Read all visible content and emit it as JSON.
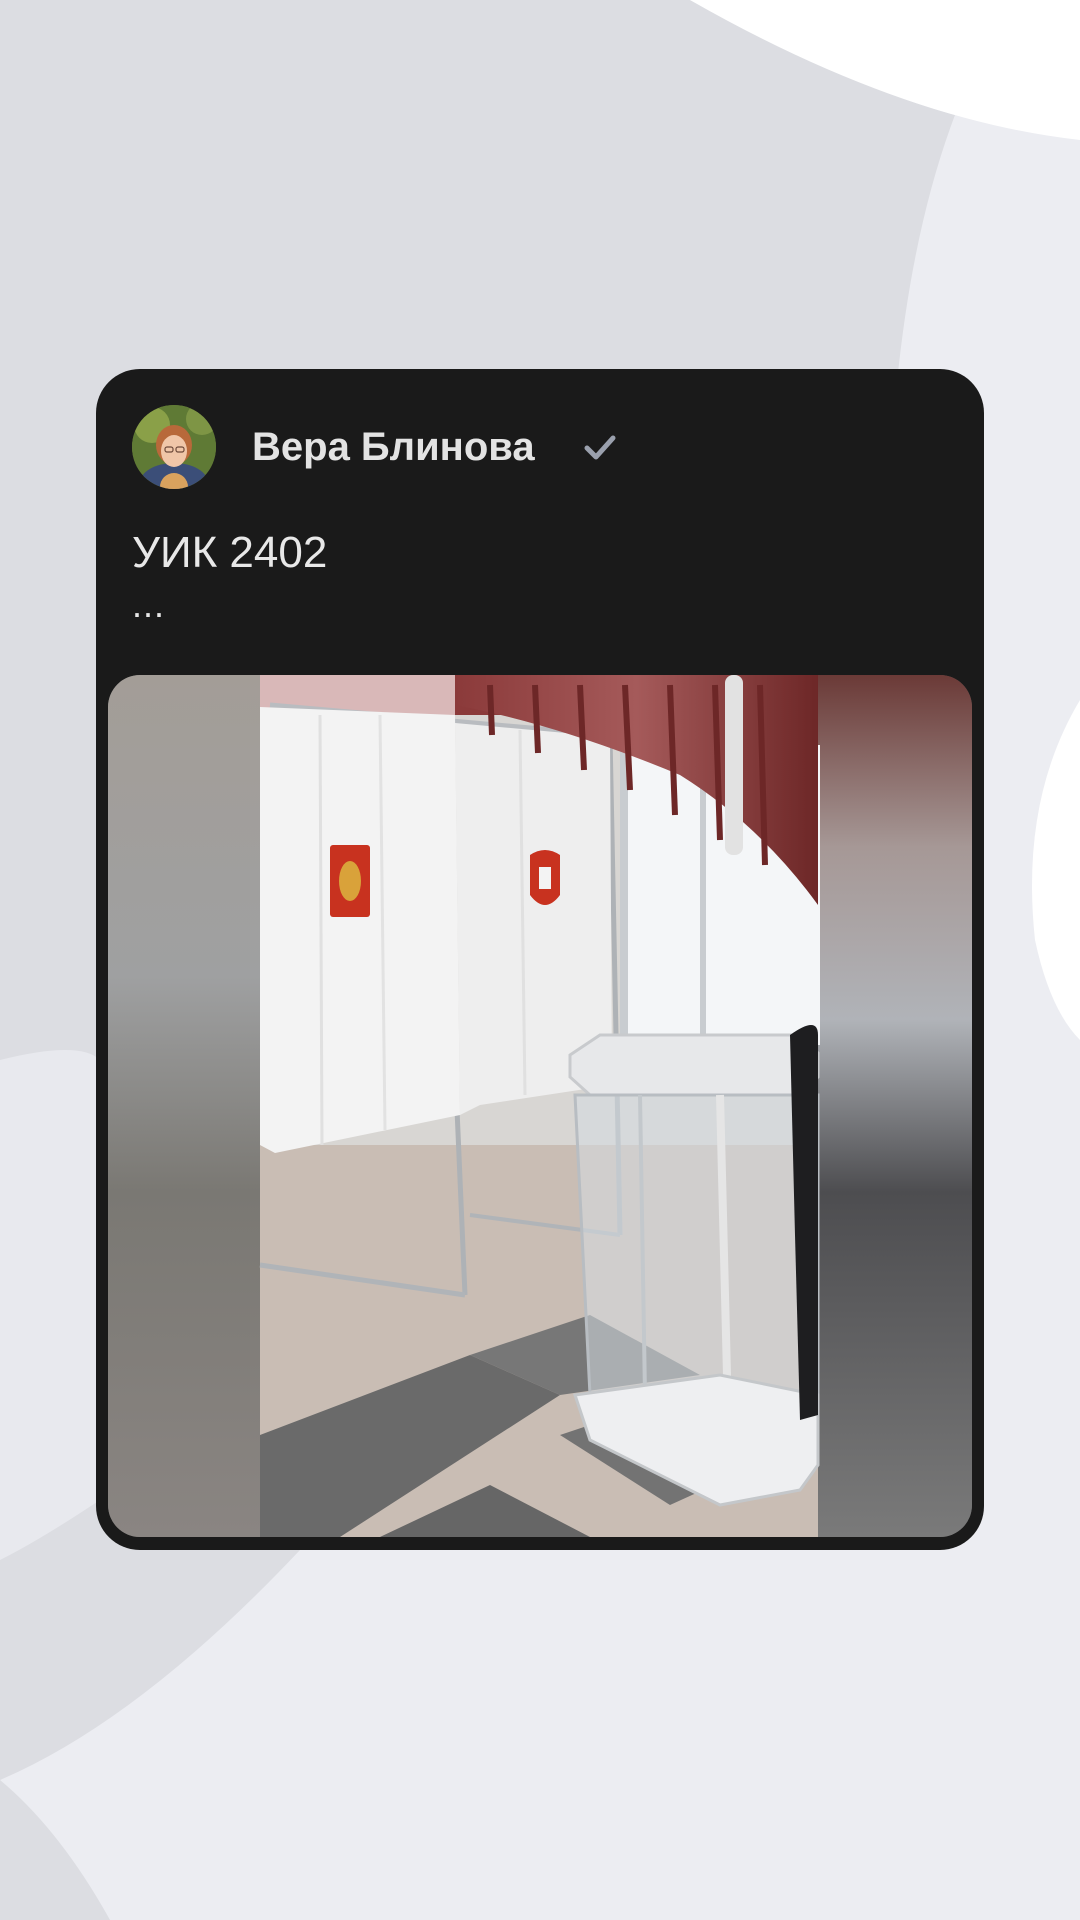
{
  "post": {
    "author": "Вера Блинова",
    "text": "УИК 2402",
    "more": "..."
  },
  "icons": {
    "verified": "checkmark-icon"
  },
  "colors": {
    "page_background": "#ecedf2",
    "card_background": "#1a1a1a",
    "text": "#e8e8e8",
    "verified_icon": "#9aa0ad"
  }
}
